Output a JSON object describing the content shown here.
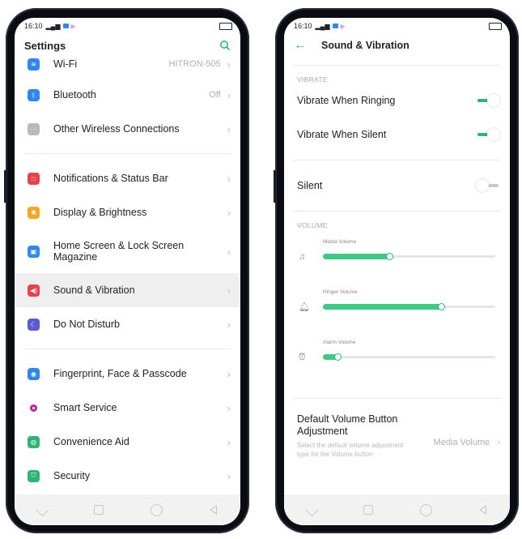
{
  "left": {
    "status": {
      "time": "16:10"
    },
    "title": "Settings",
    "items": [
      {
        "label": "Wi-Fi",
        "value": "HITRON-505",
        "color": "#2e88f0",
        "icon": "wifi-icon"
      },
      {
        "label": "Bluetooth",
        "value": "Off",
        "color": "#2e88f0",
        "icon": "bluetooth-icon"
      },
      {
        "label": "Other Wireless Connections",
        "value": "",
        "color": "#b5b9c2",
        "icon": "more-icon"
      },
      {
        "label": "Notifications & Status Bar",
        "value": "",
        "color": "#e8404c",
        "icon": "notification-icon"
      },
      {
        "label": "Display & Brightness",
        "value": "",
        "color": "#f7a623",
        "icon": "sun-icon"
      },
      {
        "label": "Home Screen & Lock Screen Magazine",
        "value": "",
        "color": "#2e88f0",
        "icon": "image-icon"
      },
      {
        "label": "Sound & Vibration",
        "value": "",
        "color": "#e8404c",
        "icon": "speaker-icon"
      },
      {
        "label": "Do Not Disturb",
        "value": "",
        "color": "#5b5bd6",
        "icon": "moon-icon"
      },
      {
        "label": "Fingerprint, Face & Passcode",
        "value": "",
        "color": "#2e88f0",
        "icon": "fingerprint-icon"
      },
      {
        "label": "Smart Service",
        "value": "",
        "color": "#c01fb0",
        "icon": "smart-icon"
      },
      {
        "label": "Convenience Aid",
        "value": "",
        "color": "#2bb673",
        "icon": "aid-icon"
      },
      {
        "label": "Security",
        "value": "",
        "color": "#2bb673",
        "icon": "shield-icon"
      }
    ]
  },
  "right": {
    "status": {
      "time": "16:10"
    },
    "title": "Sound & Vibration",
    "vibrate_section": "VIBRATE",
    "vibrate_ringing": "Vibrate When Ringing",
    "vibrate_silent": "Vibrate When Silent",
    "silent": "Silent",
    "toggles": {
      "vibrate_ringing": true,
      "vibrate_silent": true,
      "silent": false
    },
    "volume_section": "VOLUME",
    "volumes": [
      {
        "label": "Media Volume",
        "level": 0.39,
        "icon": "music-note-icon"
      },
      {
        "label": "Ringer Volume",
        "level": 0.69,
        "icon": "bell-icon"
      },
      {
        "label": "Alarm Volume",
        "level": 0.09,
        "icon": "alarm-clock-icon"
      }
    ],
    "default_title": "Default Volume Button Adjustment",
    "default_sub": "Select the default volume adjustment type for the Volume button",
    "default_value": "Media Volume",
    "accent": "#2bb673"
  }
}
